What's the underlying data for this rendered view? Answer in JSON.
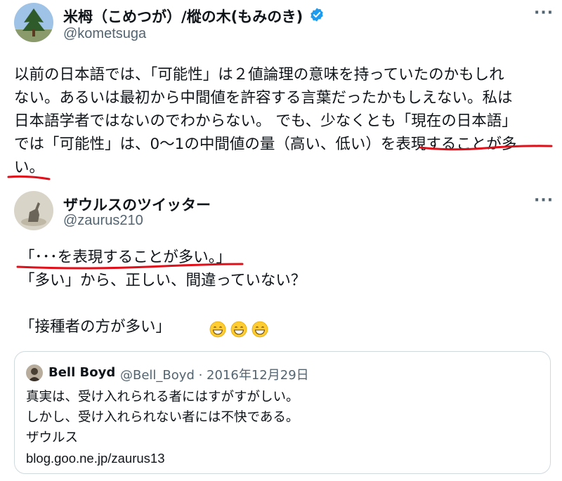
{
  "tweet1": {
    "name": "米栂（こめつが）/樅の木(もみのき)",
    "handle": "@kometsuga",
    "more_icon": "more-horizontal-icon",
    "verified_icon": "verified-badge-icon",
    "lines": [
      "以前の日本語では、「可能性」は２値論理の意味を持っていたのかもしれ",
      "ない。あるいは最初から中間値を許容する言葉だったかもしえない。私は",
      "日本語学者ではないのでわからない。 でも、少なくとも「現在の日本語」",
      "では「可能性」は、0〜1の中間値の量（高い、低い）を表現することが多",
      "い。"
    ]
  },
  "tweet2": {
    "name": "ザウルスのツイッター",
    "handle": "@zaurus210",
    "more_icon": "more-horizontal-icon",
    "lines": [
      "「･･･を表現することが多い。」",
      "「多い」から、正しい、間違っていない？",
      "",
      "「接種者の方が多い」"
    ],
    "emoji_icon": "grinning-face-emoji"
  },
  "quote": {
    "name": "Bell Boyd",
    "meta": "@Bell_Boyd · 2016年12月29日",
    "lines": [
      "真実は、受け入れられる者にはすがすがしい。",
      "しかし、受け入れられない者には不快である。",
      "ザウルス",
      "blog.goo.ne.jp/zaurus13"
    ]
  },
  "colors": {
    "text": "#0f1419",
    "secondary": "#536471",
    "verified": "#1d9bf0",
    "annotation": "#e0101a",
    "border": "#cfd9de"
  }
}
